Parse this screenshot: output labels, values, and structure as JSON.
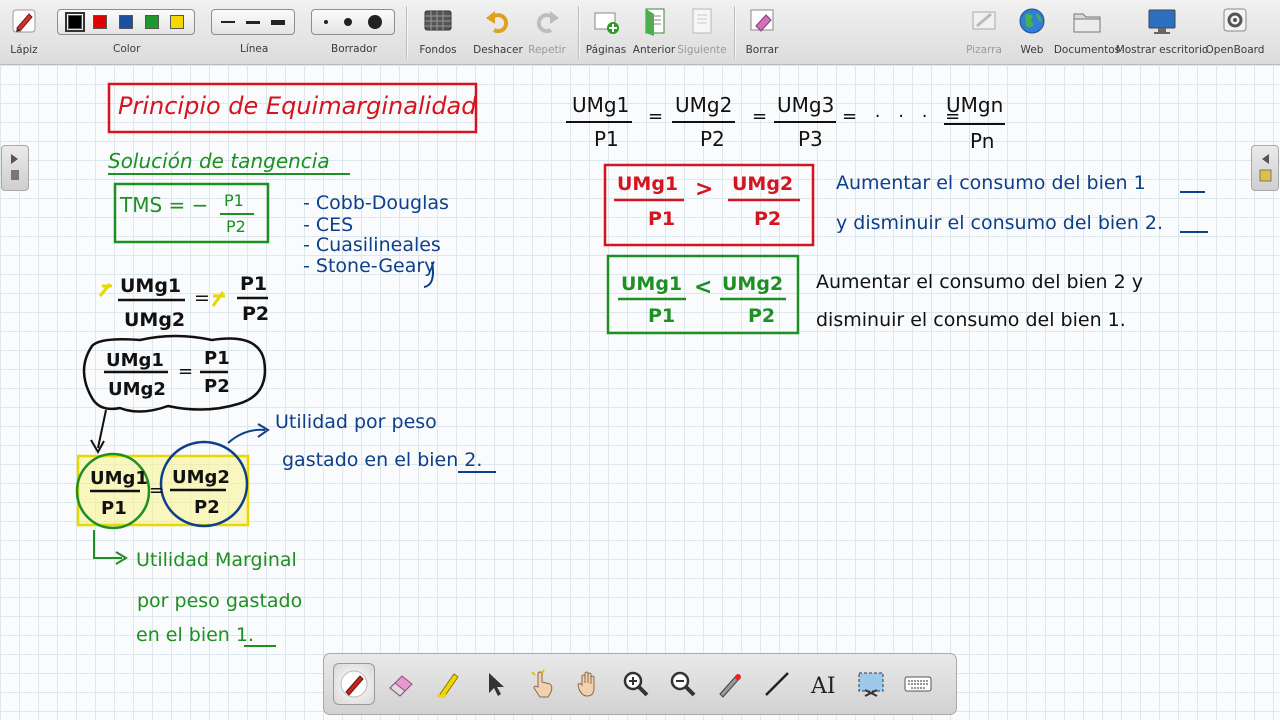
{
  "toolbar": {
    "lapiz": "Lápiz",
    "color": "Color",
    "linea": "Línea",
    "borrador": "Borrador",
    "fondos": "Fondos",
    "deshacer": "Deshacer",
    "repetir": "Repetir",
    "paginas": "Páginas",
    "anterior": "Anterior",
    "siguiente": "Siguiente",
    "borrar": "Borrar",
    "pizarra": "Pizarra",
    "web": "Web",
    "documentos": "Documentos",
    "mostrar_escritorio": "Mostrar escritorio",
    "openboard": "OpenBoard",
    "palette_colors": [
      "#000000",
      "#e00000",
      "#1a4fa3",
      "#1f9a2a",
      "#f5d800"
    ],
    "selected_color": "#000000"
  },
  "board": {
    "title": "Principio de Equimarginalidad",
    "tangencia_heading": "Solución de tangencia",
    "tms_box": {
      "lhs": "TMS = −",
      "num": "P1",
      "den": "P2"
    },
    "function_list": [
      "- Cobb-Douglas",
      "- CES",
      "- Cuasilineales",
      "- Stone-Geary"
    ],
    "eq1": {
      "lhs_num": "UMg1",
      "lhs_den": "UMg2",
      "eq": "=",
      "rhs_num": "P1",
      "rhs_den": "P2"
    },
    "eq2": {
      "lhs_num": "UMg1",
      "lhs_den": "UMg2",
      "eq": "=",
      "rhs_num": "P1",
      "rhs_den": "P2"
    },
    "eq3": {
      "lhs_num": "UMg1",
      "lhs_den": "P1",
      "eq": "=",
      "rhs_num": "UMg2",
      "rhs_den": "P2"
    },
    "note_blue_1": "Utilidad por peso",
    "note_blue_2": "gastado en el bien 2.",
    "note_green_1": "Utilidad Marginal",
    "note_green_2": "por peso gastado",
    "note_green_3": "en el bien 1.",
    "general": {
      "t1n": "UMg1",
      "t1d": "P1",
      "t2n": "UMg2",
      "t2d": "P2",
      "t3n": "UMg3",
      "t3d": "P3",
      "dots": "= · · · =",
      "tnn": "UMgn",
      "tnd": "Pn",
      "eq": "="
    },
    "red_box": {
      "ln": "UMg1",
      "ld": "P1",
      "op": ">",
      "rn": "UMg2",
      "rd": "P2"
    },
    "red_note_1": "Aumentar el consumo del bien 1",
    "red_note_2": "y disminuir el consumo del bien 2.",
    "green_box": {
      "ln": "UMg1",
      "ld": "P1",
      "op": "<",
      "rn": "UMg2",
      "rd": "P2"
    },
    "green_note_1": "Aumentar el consumo del bien 2 y",
    "green_note_2": "disminuir el consumo del bien 1."
  },
  "ink_colors": {
    "red": "#d4141e",
    "green": "#1e8f22",
    "blue": "#0d3f8a",
    "black": "#111111",
    "yellow": "#e8d800"
  }
}
